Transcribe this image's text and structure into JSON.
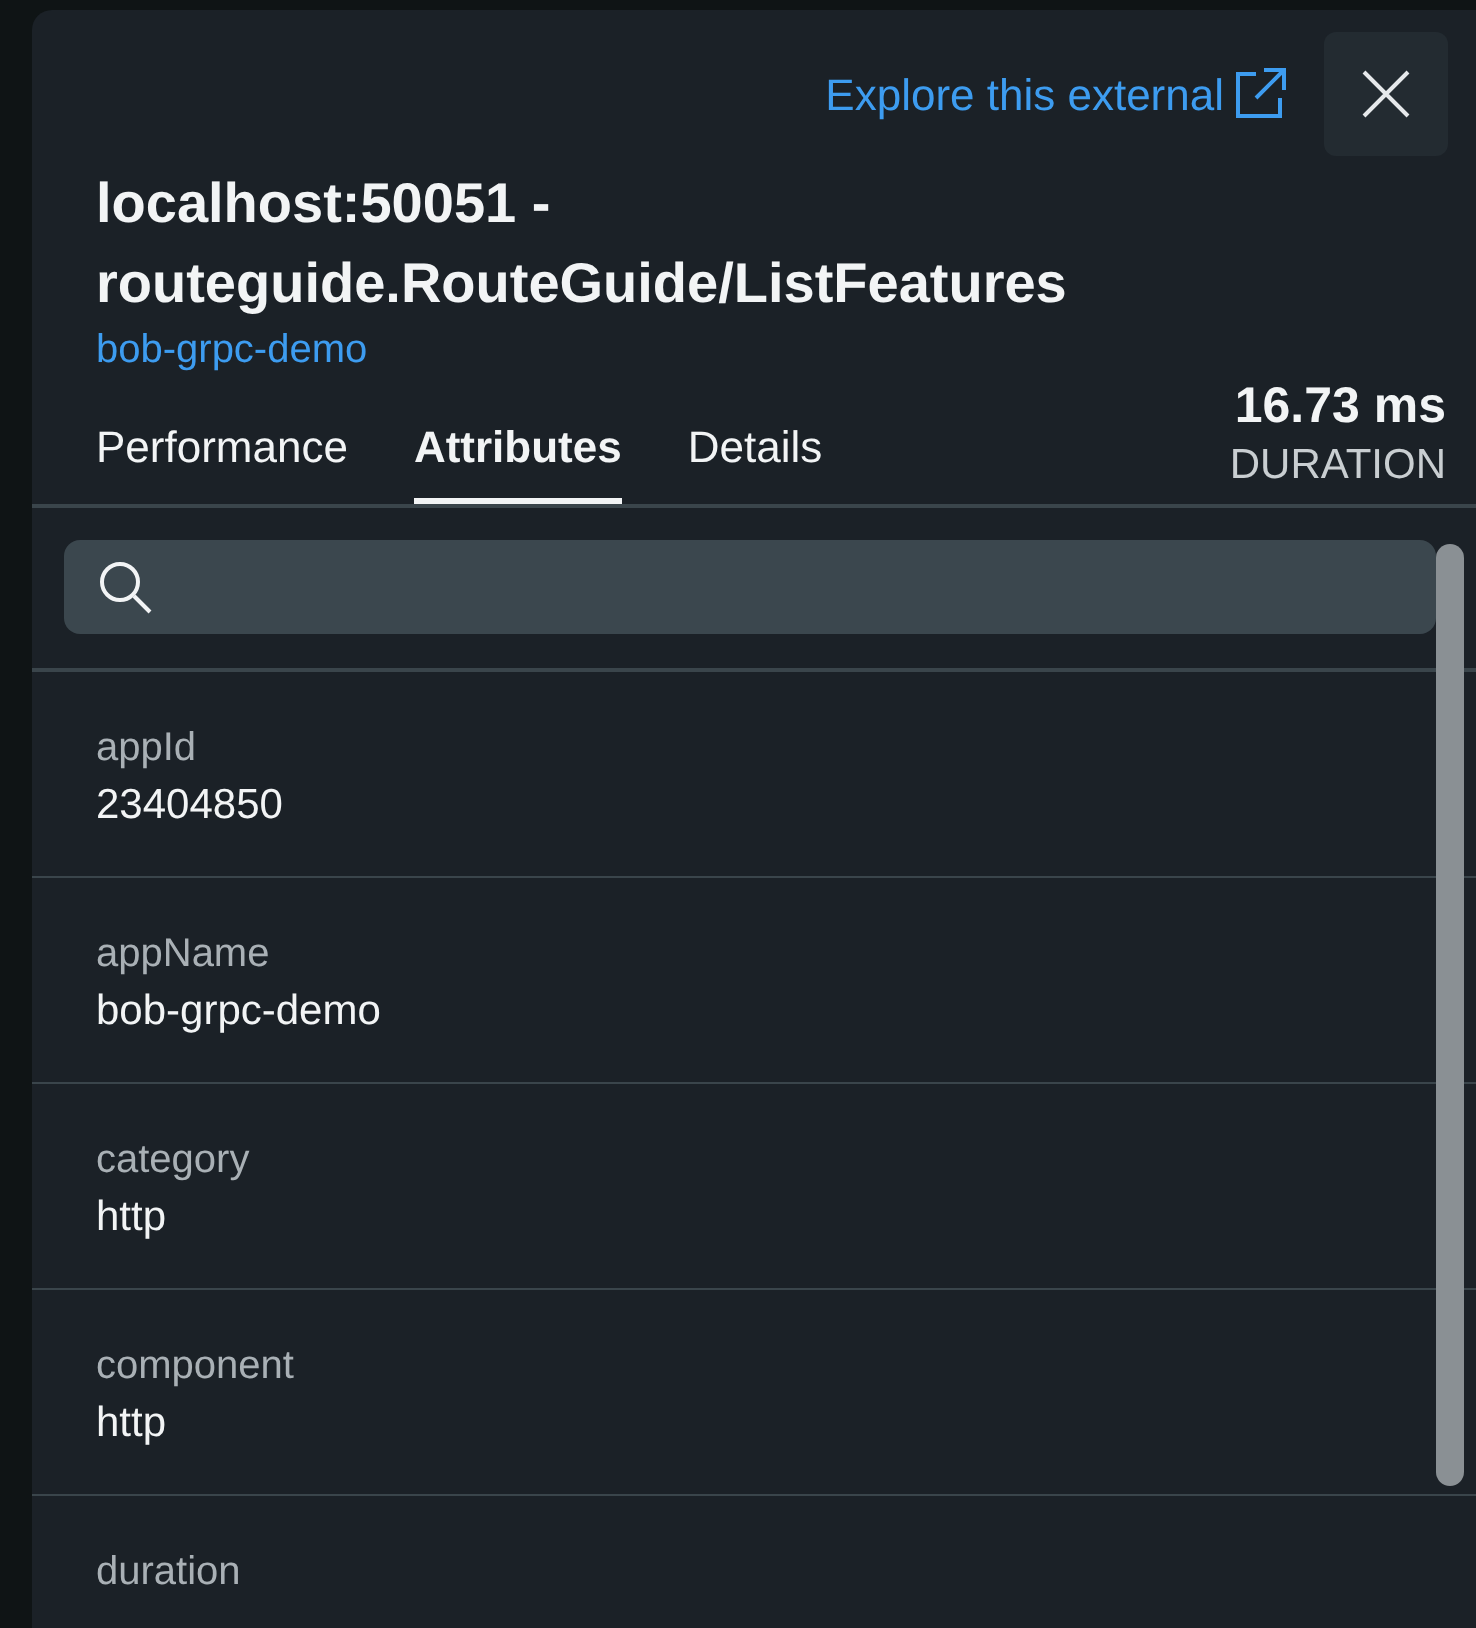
{
  "header": {
    "external_link": "Explore this external",
    "title": "localhost:50051 - routeguide.RouteGuide/ListFeatures",
    "entity_link": "bob-grpc-demo",
    "duration": {
      "value": "16.73 ms",
      "label": "DURATION"
    }
  },
  "tabs": [
    {
      "label": "Performance",
      "selected": false
    },
    {
      "label": "Attributes",
      "selected": true
    },
    {
      "label": "Details",
      "selected": false
    }
  ],
  "attributes": [
    {
      "name": "appId",
      "value": "23404850"
    },
    {
      "name": "appName",
      "value": "bob-grpc-demo"
    },
    {
      "name": "category",
      "value": "http"
    },
    {
      "name": "component",
      "value": "http"
    },
    {
      "name": "duration"
    }
  ]
}
